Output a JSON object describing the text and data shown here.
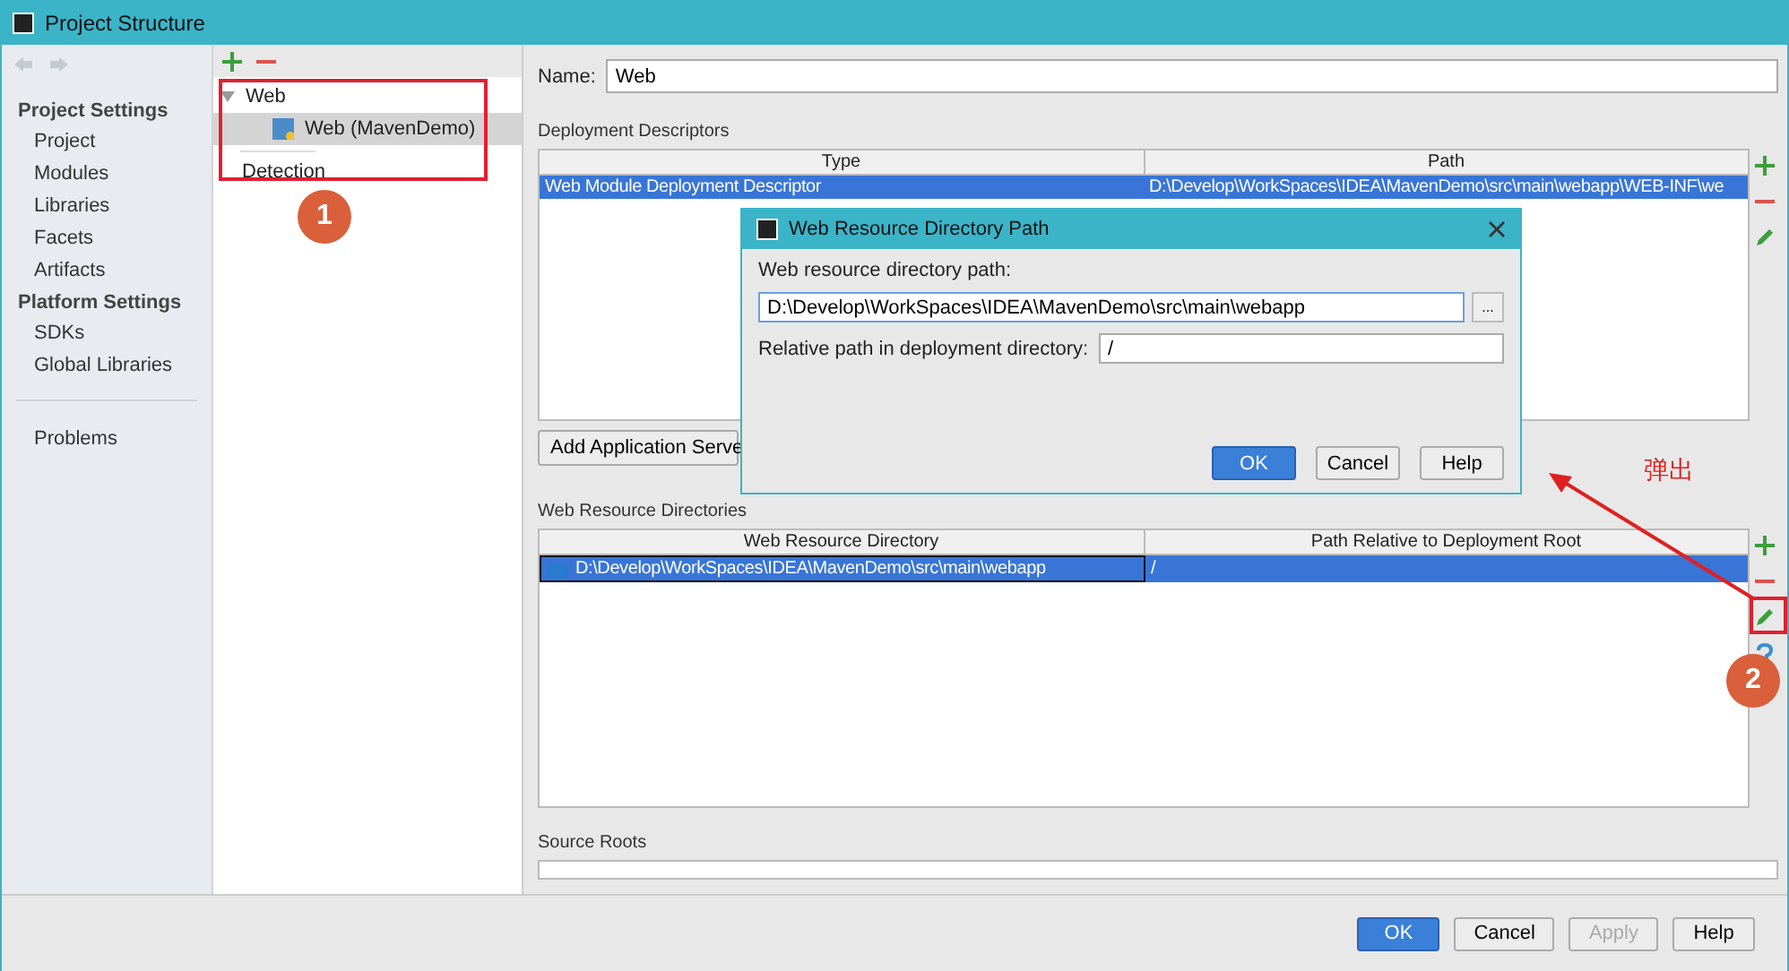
{
  "window": {
    "title": "Project Structure"
  },
  "sidebar": {
    "sections": [
      {
        "heading": "Project Settings",
        "items": [
          {
            "label": "Project"
          },
          {
            "label": "Modules"
          },
          {
            "label": "Libraries"
          },
          {
            "label": "Facets"
          },
          {
            "label": "Artifacts"
          }
        ]
      },
      {
        "heading": "Platform Settings",
        "items": [
          {
            "label": "SDKs"
          },
          {
            "label": "Global Libraries"
          }
        ]
      }
    ],
    "footer_items": [
      {
        "label": "Problems"
      }
    ]
  },
  "tree": {
    "nodes": [
      {
        "label": "Web",
        "expanded": true,
        "selected": false,
        "children": [
          {
            "label": "Web (MavenDemo)",
            "selected": true
          }
        ]
      }
    ],
    "detection": "Detection"
  },
  "name_field": {
    "label": "Name:",
    "value": "Web"
  },
  "deployment_descriptors": {
    "title": "Deployment Descriptors",
    "columns": [
      "Type",
      "Path"
    ],
    "rows": [
      {
        "cells": [
          "Web Module Deployment Descriptor",
          "D:\\Develop\\WorkSpaces\\IDEA\\MavenDemo\\src\\main\\webapp\\WEB-INF\\we"
        ],
        "selected": true
      }
    ],
    "add_button": "Add Application Serve"
  },
  "web_resource_directories": {
    "title": "Web Resource Directories",
    "columns": [
      "Web Resource Directory",
      "Path Relative to Deployment Root"
    ],
    "rows": [
      {
        "cells": [
          "D:\\Develop\\WorkSpaces\\IDEA\\MavenDemo\\src\\main\\webapp",
          "/"
        ],
        "selected": true
      }
    ]
  },
  "source_roots": {
    "title": "Source Roots"
  },
  "dialog": {
    "title": "Web Resource Directory Path",
    "fields": [
      {
        "label": "Web resource directory path:",
        "value": "D:\\Develop\\WorkSpaces\\IDEA\\MavenDemo\\src\\main\\webapp",
        "browse": "..."
      },
      {
        "label": "Relative path in deployment directory:",
        "value": "/"
      }
    ],
    "buttons": [
      {
        "label": "OK",
        "primary": true
      },
      {
        "label": "Cancel",
        "primary": false
      },
      {
        "label": "Help",
        "primary": false
      }
    ]
  },
  "footer_buttons": [
    {
      "label": "OK",
      "primary": true,
      "disabled": false
    },
    {
      "label": "Cancel",
      "primary": false,
      "disabled": false
    },
    {
      "label": "Apply",
      "primary": false,
      "disabled": true
    },
    {
      "label": "Help",
      "primary": false,
      "disabled": false
    }
  ],
  "annotations": {
    "callouts": [
      "1",
      "2"
    ],
    "popup_label": "弹出"
  }
}
